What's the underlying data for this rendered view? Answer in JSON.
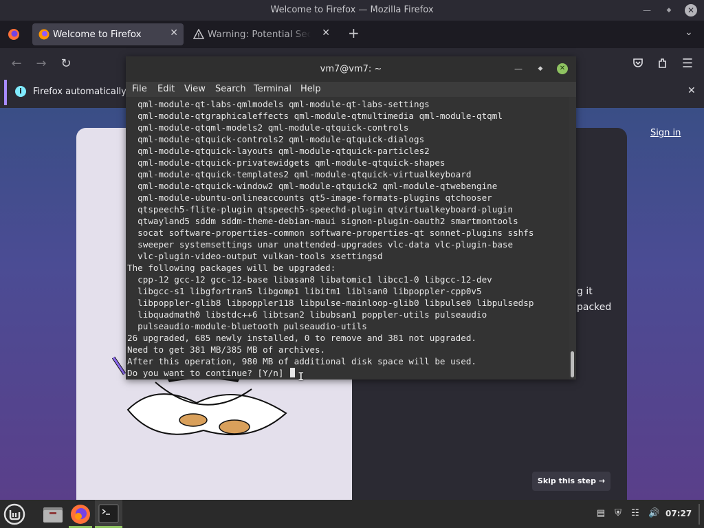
{
  "firefox": {
    "window_title": "Welcome to Firefox — Mozilla Firefox",
    "tabs": [
      {
        "label": "Welcome to Firefox",
        "active": true
      },
      {
        "label": "Warning: Potential Security Risk Ahead",
        "active": false
      }
    ],
    "new_tab": "+",
    "notification": "Firefox automatically se",
    "page": {
      "sign_in": "Sign in",
      "frag1": "g it",
      "frag2": "packed",
      "skip": "Skip this step →"
    }
  },
  "terminal": {
    "title": "vm7@vm7: ~",
    "menu": [
      "File",
      "Edit",
      "View",
      "Search",
      "Terminal",
      "Help"
    ],
    "lines": [
      "  qml-module-qt-labs-qmlmodels qml-module-qt-labs-settings",
      "  qml-module-qtgraphicaleffects qml-module-qtmultimedia qml-module-qtqml",
      "  qml-module-qtqml-models2 qml-module-qtquick-controls",
      "  qml-module-qtquick-controls2 qml-module-qtquick-dialogs",
      "  qml-module-qtquick-layouts qml-module-qtquick-particles2",
      "  qml-module-qtquick-privatewidgets qml-module-qtquick-shapes",
      "  qml-module-qtquick-templates2 qml-module-qtquick-virtualkeyboard",
      "  qml-module-qtquick-window2 qml-module-qtquick2 qml-module-qtwebengine",
      "  qml-module-ubuntu-onlineaccounts qt5-image-formats-plugins qtchooser",
      "  qtspeech5-flite-plugin qtspeech5-speechd-plugin qtvirtualkeyboard-plugin",
      "  qtwayland5 sddm sddm-theme-debian-maui signon-plugin-oauth2 smartmontools",
      "  socat software-properties-common software-properties-qt sonnet-plugins sshfs",
      "  sweeper systemsettings unar unattended-upgrades vlc-data vlc-plugin-base",
      "  vlc-plugin-video-output vulkan-tools xsettingsd",
      "The following packages will be upgraded:",
      "  cpp-12 gcc-12 gcc-12-base libasan8 libatomic1 libcc1-0 libgcc-12-dev",
      "  libgcc-s1 libgfortran5 libgomp1 libitm1 liblsan0 libpoppler-cpp0v5",
      "  libpoppler-glib8 libpoppler118 libpulse-mainloop-glib0 libpulse0 libpulsedsp",
      "  libquadmath0 libstdc++6 libtsan2 libubsan1 poppler-utils pulseaudio",
      "  pulseaudio-module-bluetooth pulseaudio-utils",
      "26 upgraded, 685 newly installed, 0 to remove and 381 not upgraded.",
      "Need to get 381 MB/385 MB of archives.",
      "After this operation, 980 MB of additional disk space will be used."
    ],
    "prompt": "Do you want to continue? [Y/n] "
  },
  "taskbar": {
    "time": "07:27"
  }
}
